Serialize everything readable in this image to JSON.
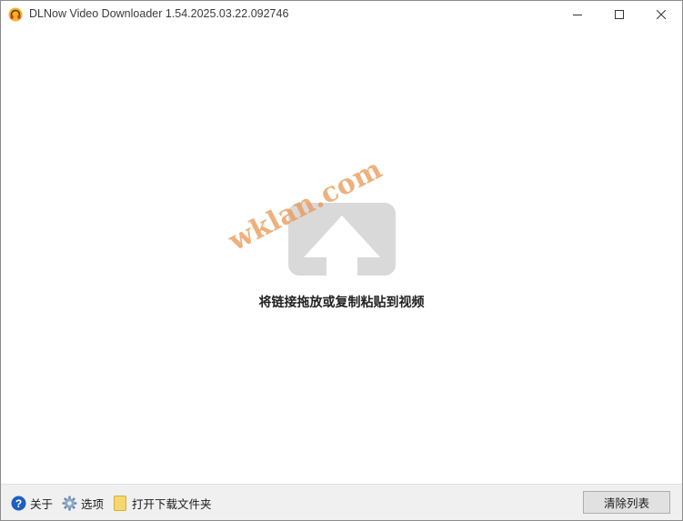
{
  "window": {
    "title": "DLNow Video Downloader 1.54.2025.03.22.092746",
    "icon": "headphones-icon"
  },
  "title_buttons": {
    "minimize_icon": "minimize-icon",
    "maximize_icon": "maximize-icon",
    "close_icon": "close-icon"
  },
  "main": {
    "drop_hint": "将链接拖放或复制粘贴到视频",
    "watermark": "wklan.com",
    "upload_icon": "upload-arrow-icon"
  },
  "toolbar": {
    "about_label": "关于",
    "options_label": "选项",
    "open_folder_label": "打开下载文件夹",
    "clear_list_label": "清除列表"
  },
  "colors": {
    "upload_graphic": "#d9d9d9",
    "watermark": "#e89650",
    "toolbar_bg": "#f0f0f0",
    "about_icon_blue": "#1e5fbf",
    "folder_yellow": "#f5d76e"
  }
}
